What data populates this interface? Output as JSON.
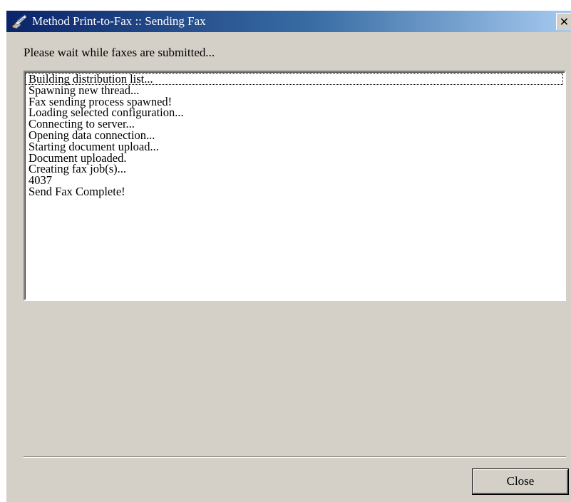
{
  "window": {
    "title": "Method Print-to-Fax :: Sending Fax",
    "icon": "fax-icon",
    "close_glyph": "✕"
  },
  "prompt": "Please wait while faxes are submitted...",
  "log": [
    "Building distribution list...",
    "Spawning new thread...",
    "Fax sending process spawned!",
    "Loading selected configuration...",
    "Connecting to server...",
    "Opening data connection...",
    "Starting document upload...",
    "Document uploaded.",
    "Creating fax job(s)...",
    "4037",
    "Send Fax Complete!"
  ],
  "buttons": {
    "close_label": "Close"
  },
  "colors": {
    "titlebar_start": "#0a246a",
    "titlebar_end": "#a6caf0",
    "dialog_face": "#d4d0c8"
  }
}
